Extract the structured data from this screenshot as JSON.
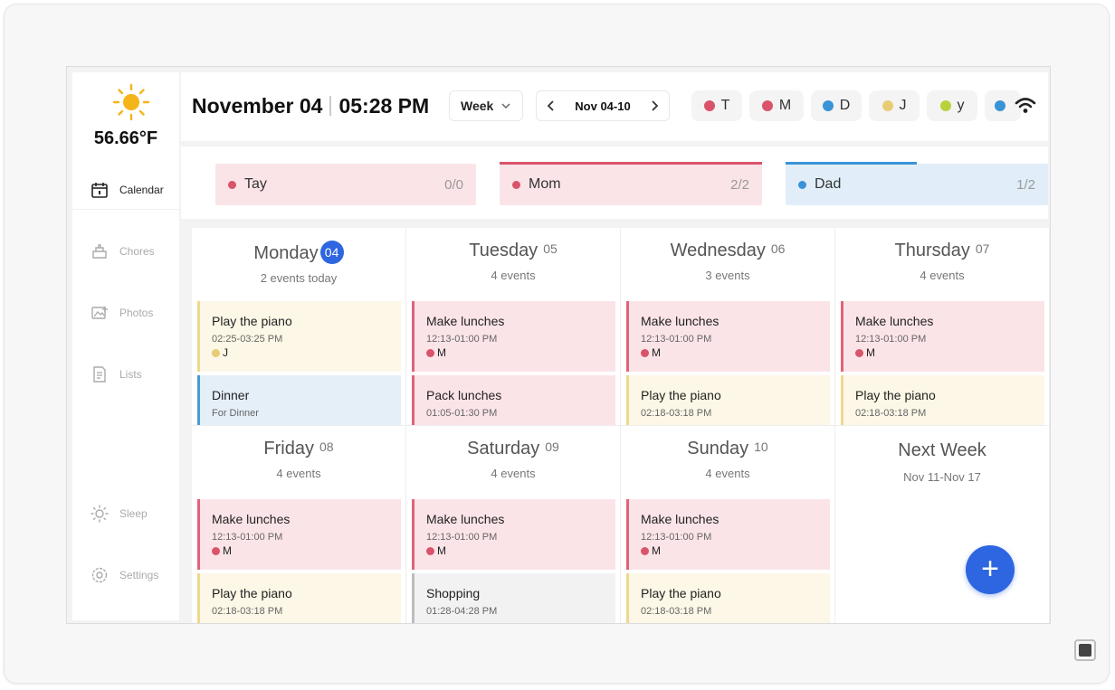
{
  "weather": {
    "temperature": "56.66°F",
    "icon": "sun-icon"
  },
  "sidebar": {
    "items": [
      {
        "label": "Calendar",
        "icon": "calendar-icon",
        "active": true
      },
      {
        "label": "Chores",
        "icon": "chores-icon"
      },
      {
        "label": "Photos",
        "icon": "photos-icon"
      },
      {
        "label": "Lists",
        "icon": "lists-icon"
      },
      {
        "label": "Sleep",
        "icon": "sleep-icon"
      },
      {
        "label": "Settings",
        "icon": "gear-icon"
      }
    ]
  },
  "header": {
    "date": "November 04",
    "time": "05:28 PM",
    "view_select": "Week",
    "range": "Nov 04-10",
    "members": [
      {
        "initial": "T",
        "color": "#d9546b"
      },
      {
        "initial": "M",
        "color": "#d9546b"
      },
      {
        "initial": "D",
        "color": "#3a93d6"
      },
      {
        "initial": "J",
        "color": "#e8cc74"
      },
      {
        "initial": "y",
        "color": "#b9d23c"
      }
    ]
  },
  "member_progress": [
    {
      "name": "Tay",
      "count": "0/0",
      "color": "#d9546b",
      "bg": "#fbe4e8",
      "fraction": 0
    },
    {
      "name": "Mom",
      "count": "2/2",
      "color": "#d9546b",
      "bg": "#fbe4e8",
      "fraction": 1
    },
    {
      "name": "Dad",
      "count": "1/2",
      "color": "#3a93d6",
      "bg": "#e1eef9",
      "fraction": 0.5
    }
  ],
  "days": [
    {
      "name": "Monday",
      "num": "04",
      "count": "2 events today",
      "today": true,
      "events": [
        {
          "title": "Play the piano",
          "time": "02:25-03:25 PM",
          "member": "J",
          "member_color": "#e8cc74",
          "bg": "#fcf7e6",
          "border": "#eed88e"
        },
        {
          "title": "Dinner",
          "time": "For Dinner",
          "member": "",
          "bg": "#e4eff8",
          "border": "#4a9ad4"
        }
      ]
    },
    {
      "name": "Tuesday",
      "num": "05",
      "count": "4 events",
      "events": [
        {
          "title": "Make lunches",
          "time": "12:13-01:00 PM",
          "member": "M",
          "member_color": "#d9546b",
          "bg": "#fbe4e8",
          "border": "#e06379"
        },
        {
          "title": "Pack lunches",
          "time": "01:05-01:30 PM",
          "member": "",
          "bg": "#fbe4e8",
          "border": "#e06379"
        }
      ]
    },
    {
      "name": "Wednesday",
      "num": "06",
      "count": "3 events",
      "events": [
        {
          "title": "Make lunches",
          "time": "12:13-01:00 PM",
          "member": "M",
          "member_color": "#d9546b",
          "bg": "#fbe4e8",
          "border": "#e06379"
        },
        {
          "title": "Play the piano",
          "time": "02:18-03:18 PM",
          "member": "",
          "bg": "#fcf7e6",
          "border": "#eed88e"
        }
      ]
    },
    {
      "name": "Thursday",
      "num": "07",
      "count": "4 events",
      "events": [
        {
          "title": "Make lunches",
          "time": "12:13-01:00 PM",
          "member": "M",
          "member_color": "#d9546b",
          "bg": "#fbe4e8",
          "border": "#e06379"
        },
        {
          "title": "Play the piano",
          "time": "02:18-03:18 PM",
          "member": "",
          "bg": "#fcf7e6",
          "border": "#eed88e"
        }
      ]
    },
    {
      "name": "Friday",
      "num": "08",
      "count": "4 events",
      "events": [
        {
          "title": "Make lunches",
          "time": "12:13-01:00 PM",
          "member": "M",
          "member_color": "#d9546b",
          "bg": "#fbe4e8",
          "border": "#e06379"
        },
        {
          "title": "Play the piano",
          "time": "02:18-03:18 PM",
          "member": "",
          "bg": "#fcf7e6",
          "border": "#eed88e"
        }
      ]
    },
    {
      "name": "Saturday",
      "num": "09",
      "count": "4 events",
      "events": [
        {
          "title": "Make lunches",
          "time": "12:13-01:00 PM",
          "member": "M",
          "member_color": "#d9546b",
          "bg": "#fbe4e8",
          "border": "#e06379"
        },
        {
          "title": "Shopping",
          "time": "01:28-04:28 PM",
          "member": "",
          "bg": "#f2f2f2",
          "border": "#bdbdbd"
        }
      ]
    },
    {
      "name": "Sunday",
      "num": "10",
      "count": "4 events",
      "events": [
        {
          "title": "Make lunches",
          "time": "12:13-01:00 PM",
          "member": "M",
          "member_color": "#d9546b",
          "bg": "#fbe4e8",
          "border": "#e06379"
        },
        {
          "title": "Play the piano",
          "time": "02:18-03:18 PM",
          "member": "",
          "bg": "#fcf7e6",
          "border": "#eed88e"
        }
      ]
    }
  ],
  "next_week": {
    "title": "Next Week",
    "range": "Nov 11-Nov 17"
  },
  "fab_label": "+"
}
